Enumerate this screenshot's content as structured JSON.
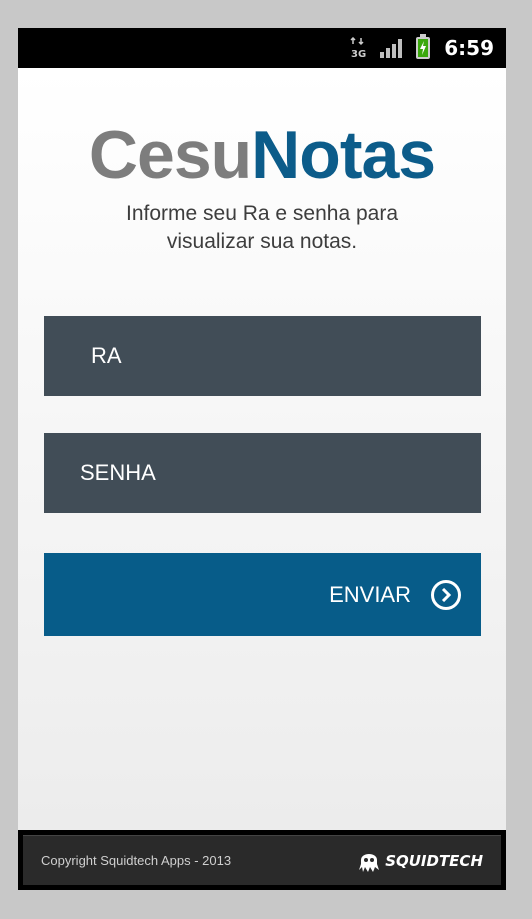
{
  "status_bar": {
    "network": "3G",
    "time": "6:59"
  },
  "brand": {
    "part1": "Cesu",
    "part2": "Notas"
  },
  "subtitle": {
    "line1": "Informe seu Ra e senha para",
    "line2": "visualizar sua notas."
  },
  "form": {
    "ra_placeholder": "RA",
    "senha_placeholder": "SENHA",
    "submit_label": "ENVIAR"
  },
  "footer": {
    "copyright": "Copyright Squidtech Apps - 2013",
    "logo_text": "SQUIDTECH"
  },
  "colors": {
    "brand_gray": "#7d7d7d",
    "brand_blue": "#0c5c8a",
    "field_bg": "#414d57",
    "button_bg": "#075c89"
  }
}
